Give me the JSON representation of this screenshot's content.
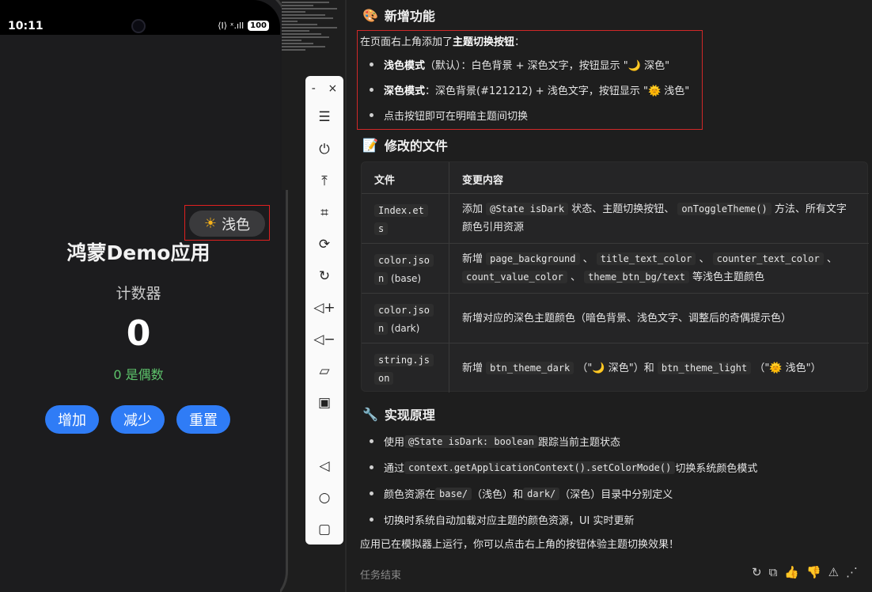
{
  "phone": {
    "status_time": "10:11",
    "status_icons": "⟨I⟩ ˣ.ıll",
    "battery": "100",
    "theme_button_label": "浅色",
    "app_title": "鸿蒙Demo应用",
    "counter_label": "计数器",
    "counter_value": "0",
    "parity_text": "0 是偶数",
    "buttons": [
      "增加",
      "减少",
      "重置"
    ]
  },
  "toolbar": {
    "minimize": "-",
    "close": "×",
    "icons": [
      "menu-icon",
      "power-icon",
      "pin-top-icon",
      "crop-icon",
      "rotate-icon",
      "rotate-lock-icon",
      "volume-up-icon",
      "volume-down-icon",
      "shake-icon",
      "multi-device-icon",
      "back-icon",
      "home-icon",
      "recents-icon"
    ]
  },
  "chat": {
    "section1_title": "新增功能",
    "intro_prefix": "在页面右上角添加了",
    "intro_bold": "主题切换按钮",
    "intro_suffix": "：",
    "b1_bold": "浅色模式",
    "b1_text": "（默认）：白色背景 + 深色文字，按钮显示 \"🌙 深色\"",
    "b2_bold": "深色模式",
    "b2_text": "：深色背景(#121212) + 浅色文字，按钮显示 \"🌞 浅色\"",
    "b3_text": "点击按钮即可在明暗主题间切换",
    "section2_title": "修改的文件",
    "table_head": [
      "文件",
      "变更内容"
    ],
    "rows": [
      {
        "file_a": "Index.et",
        "file_b": "s",
        "file_suffix": "",
        "c1_pre": "添加 ",
        "c1_code1": "@State isDark",
        "c1_mid": " 状态、主题切换按钮、 ",
        "c1_code2": "onToggleTheme()",
        "c1_post": " 方法、所有文字",
        "c1_line2": "颜色引用资源"
      },
      {
        "file_a": "color.jso",
        "file_b": "n",
        "file_suffix": " (base)",
        "c2_pre": "新增 ",
        "c2_code1": "page_background",
        "c2_sep1": " 、 ",
        "c2_code2": "title_text_color",
        "c2_sep2": " 、 ",
        "c2_code3": "counter_text_color",
        "c2_sep3": " 、",
        "c2_code4": "count_value_color",
        "c2_sep4": " 、 ",
        "c2_code5": "theme_btn_bg/text",
        "c2_post": " 等浅色主题颜色"
      },
      {
        "file_a": "color.jso",
        "file_b": "n",
        "file_suffix": " (dark)",
        "c3_text": "新增对应的深色主题颜色（暗色背景、浅色文字、调整后的奇偶提示色）"
      },
      {
        "file_a": "string.js",
        "file_b": "on",
        "file_suffix": "",
        "c4_pre": "新增 ",
        "c4_code1": "btn_theme_dark",
        "c4_mid": " （\"🌙 深色\"）和 ",
        "c4_code2": "btn_theme_light",
        "c4_post": " （\"🌞 浅色\"）"
      }
    ],
    "section3_title": "实现原理",
    "p1_pre": "使用 ",
    "p1_code": "@State isDark: boolean",
    "p1_post": " 跟踪当前主题状态",
    "p2_pre": "通过 ",
    "p2_code": "context.getApplicationContext().setColorMode()",
    "p2_post": " 切换系统颜色模式",
    "p3_pre": "颜色资源在 ",
    "p3_code1": "base/",
    "p3_mid1": " （浅色）和 ",
    "p3_code2": "dark/",
    "p3_post": " （深色）目录中分别定义",
    "p4_text": "切换时系统自动加载对应主题的颜色资源，UI 实时更新",
    "closing": "应用已在模拟器上运行，你可以点击右上角的按钮体验主题切换效果！",
    "footer_status": "任务结束"
  },
  "colors": {
    "accent_blue": "#2f7cf6",
    "highlight_red": "#d02828",
    "parity_green": "#5dc36b"
  }
}
